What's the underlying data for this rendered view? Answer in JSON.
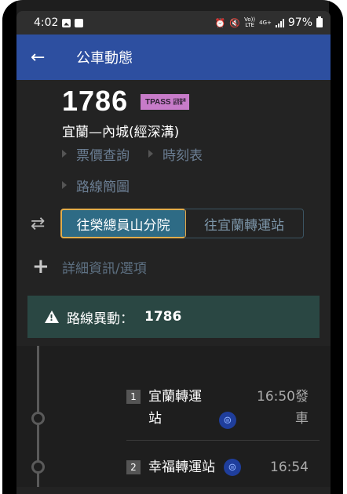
{
  "status": {
    "time": "4:02",
    "signal": "Vo)) LTE",
    "network": "4G+",
    "battery": "97%"
  },
  "appbar": {
    "title": "公車動態"
  },
  "route": {
    "number": "1786",
    "badge": "TPASS",
    "badge_small": "行政院通勤月票",
    "name": "宜蘭—內城(經深溝)"
  },
  "links": [
    "票價查詢",
    "時刻表",
    "路線簡圖"
  ],
  "direction": {
    "active": "往榮總員山分院",
    "inactive": "往宜蘭轉運站"
  },
  "details": {
    "label": "詳細資訊/選項"
  },
  "notice": {
    "label": "路線異動：",
    "route": "1786"
  },
  "stops": [
    {
      "num": "1",
      "name_line1": "宜蘭轉運",
      "name_line2": "站",
      "time_line1": "16:50發",
      "time_line2": "車",
      "icon": "taiwan-railway-icon"
    },
    {
      "num": "2",
      "name": "幸福轉運站",
      "time": "16:54",
      "icon": "taiwan-railway-icon"
    }
  ]
}
